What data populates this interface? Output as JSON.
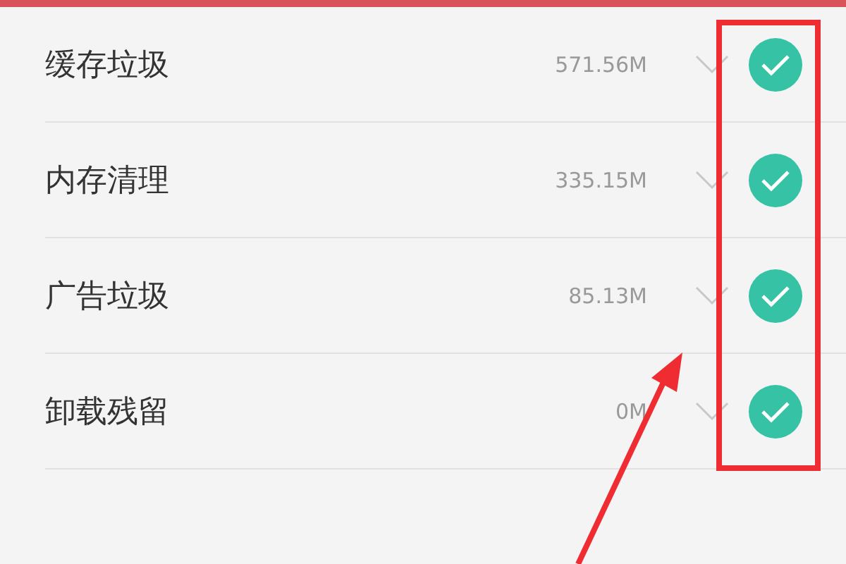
{
  "items": [
    {
      "label": "缓存垃圾",
      "size": "571.56M",
      "checked": true
    },
    {
      "label": "内存清理",
      "size": "335.15M",
      "checked": true
    },
    {
      "label": "广告垃圾",
      "size": "85.13M",
      "checked": true
    },
    {
      "label": "卸载残留",
      "size": "0M",
      "checked": true
    }
  ]
}
